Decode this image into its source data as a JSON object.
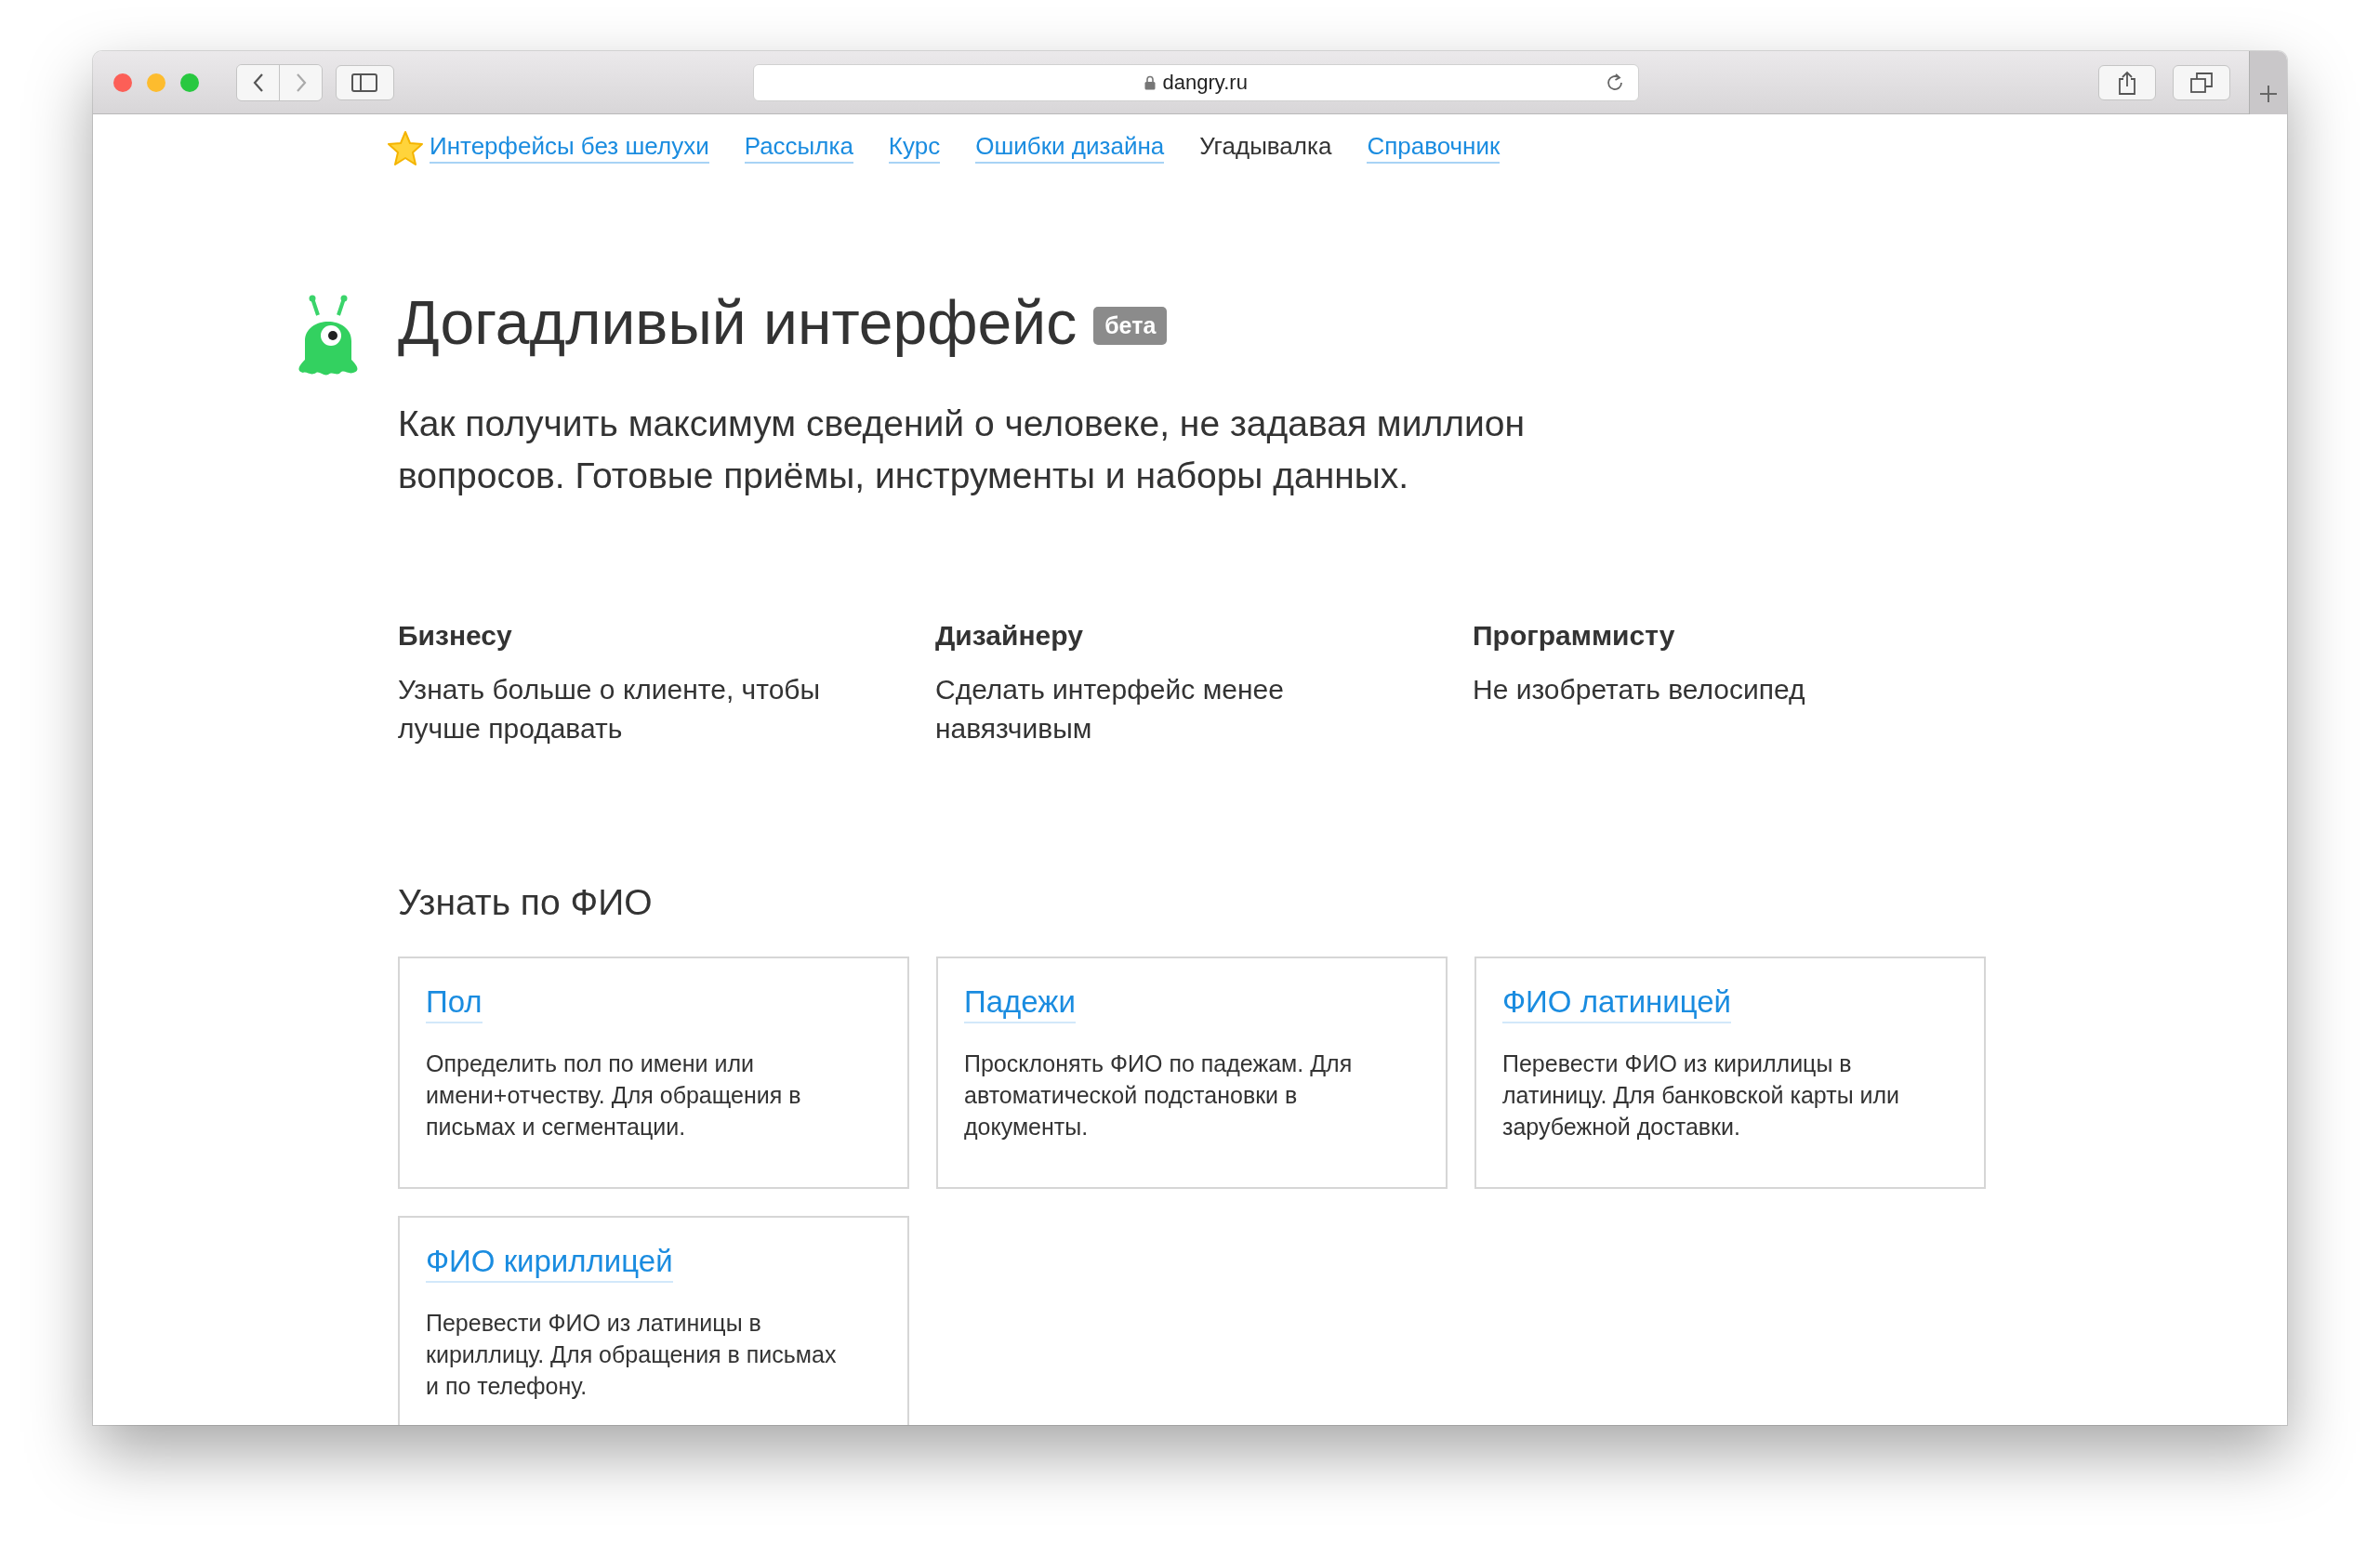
{
  "browser": {
    "url": "dangry.ru"
  },
  "nav": [
    {
      "label": "Интерфейсы без шелухи",
      "selected": false,
      "kind": "home"
    },
    {
      "label": "Рассылка",
      "selected": false,
      "kind": "link"
    },
    {
      "label": "Курс",
      "selected": false,
      "kind": "link"
    },
    {
      "label": "Ошибки дизайна",
      "selected": false,
      "kind": "link"
    },
    {
      "label": "Угадывалка",
      "selected": true,
      "kind": "link"
    },
    {
      "label": "Справочник",
      "selected": false,
      "kind": "link"
    }
  ],
  "header": {
    "title": "Догадливый интерфейс",
    "badge": "бета",
    "subtitle": "Как получить максимум сведений о человеке, не задавая миллион вопросов. Готовые приёмы, инструменты и наборы данных."
  },
  "audiences": [
    {
      "title": "Бизнесу",
      "text": "Узнать больше о клиенте, чтобы лучше продавать"
    },
    {
      "title": "Дизайнеру",
      "text": "Сделать интерфейс менее навязчивым"
    },
    {
      "title": "Программисту",
      "text": "Не изобретать велосипед"
    }
  ],
  "section": {
    "title": "Узнать по ФИО",
    "cards": [
      {
        "title": "Пол",
        "text": "Определить пол по имени или имени+отчеству. Для обращения в письмах и сегментации."
      },
      {
        "title": "Падежи",
        "text": "Просклонять ФИО по падежам. Для автоматической подстановки в документы."
      },
      {
        "title": "ФИО латиницей",
        "text": "Перевести ФИО из кириллицы в латиницу. Для банковской карты или зарубежной доставки."
      },
      {
        "title": "ФИО кириллицей",
        "text": "Перевести ФИО из латиницы в кириллицу. Для обращения в письмах и по телефону."
      }
    ]
  }
}
